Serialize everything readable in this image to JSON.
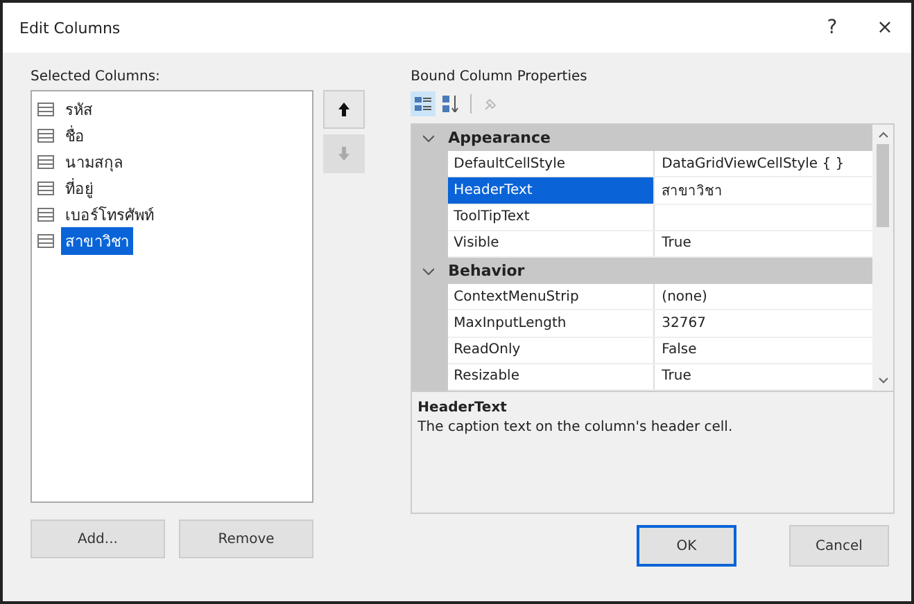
{
  "window": {
    "title": "Edit Columns",
    "help": "?",
    "close": "×"
  },
  "selected_columns": {
    "label": "Selected Columns:",
    "items": [
      {
        "text": "รหัส",
        "selected": false
      },
      {
        "text": "ชื่อ",
        "selected": false
      },
      {
        "text": "นามสกุล",
        "selected": false
      },
      {
        "text": "ที่อยู่",
        "selected": false
      },
      {
        "text": "เบอร์โทรศัพท์",
        "selected": false
      },
      {
        "text": "สาขาวิชา",
        "selected": true
      }
    ]
  },
  "move_buttons": [
    {
      "kind": "up",
      "disabled": false
    },
    {
      "kind": "down",
      "disabled": true
    }
  ],
  "list_buttons": [
    "Add...",
    "Remove"
  ],
  "properties": {
    "label": "Bound Column Properties",
    "toolbar": [
      {
        "kind": "categorized",
        "selected": true
      },
      {
        "kind": "alphabetical",
        "selected": false
      },
      {
        "kind": "pages",
        "selected": false
      }
    ],
    "categories": [
      {
        "name": "Appearance",
        "expanded": true,
        "rows": [
          {
            "name": "DefaultCellStyle",
            "value": "DataGridViewCellStyle { }",
            "selected": false
          },
          {
            "name": "HeaderText",
            "value": "สาขาวิชา",
            "selected": true
          },
          {
            "name": "ToolTipText",
            "selected": false
          },
          {
            "name": "Visible",
            "value": "True",
            "selected": false
          }
        ]
      },
      {
        "name": "Behavior",
        "expanded": true,
        "rows": [
          {
            "name": "ContextMenuStrip",
            "value": "(none)",
            "selected": false
          },
          {
            "name": "MaxInputLength",
            "value": "32767",
            "selected": false
          },
          {
            "name": "ReadOnly",
            "value": "False",
            "selected": false
          },
          {
            "name": "Resizable",
            "value": "True",
            "selected": false
          }
        ]
      }
    ],
    "description": {
      "title": "HeaderText",
      "text": "The caption text on the column's header cell."
    }
  },
  "buttons": [
    "OK",
    "Cancel"
  ]
}
